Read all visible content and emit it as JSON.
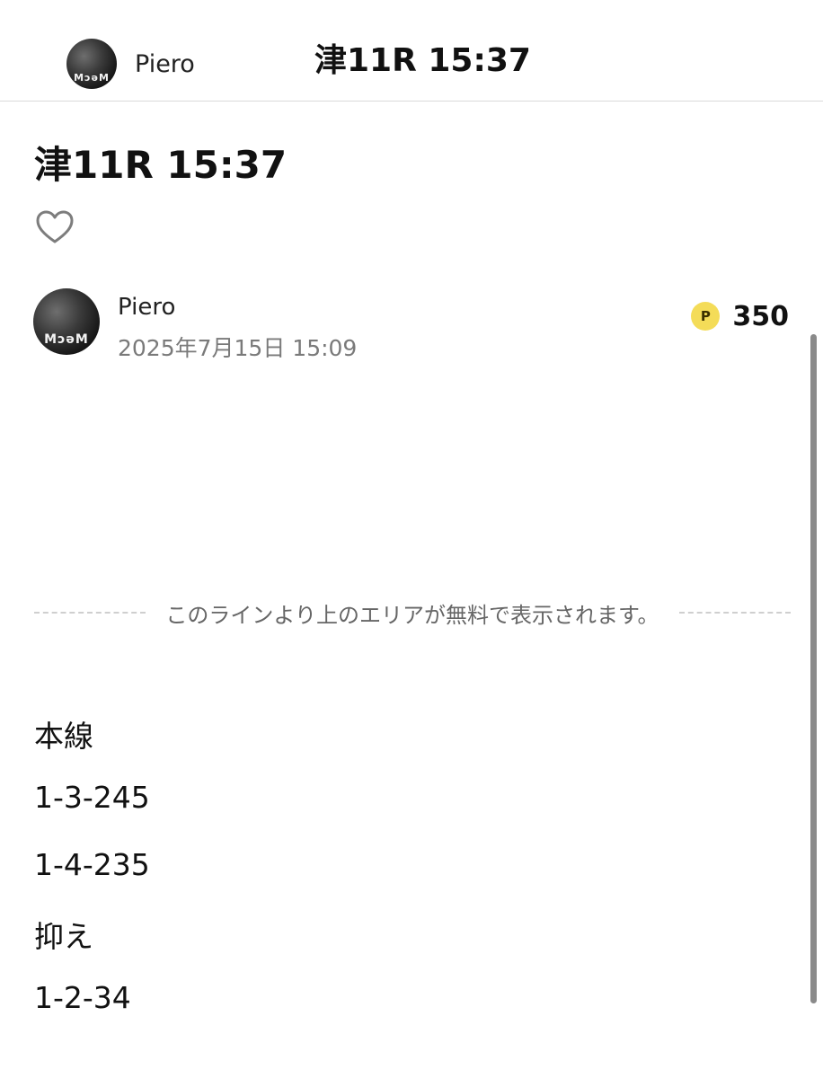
{
  "header": {
    "author": "Piero",
    "title": "津11R 15:37"
  },
  "article": {
    "title": "津11R 15:37",
    "author_name": "Piero",
    "published": "2025年7月15日 15:09",
    "price_symbol": "P",
    "price": "350",
    "free_area_notice": "このラインより上のエリアが無料で表示されます。",
    "lines": [
      "本線",
      "1-3-245",
      "1-4-235",
      "抑え",
      "1-2-34"
    ]
  },
  "avatar_text": "MɔəM",
  "icons": {
    "like": "heart-outline-icon",
    "price": "point-coin-icon"
  },
  "colors": {
    "coin": "#f4dc58",
    "muted": "#7a7a7a"
  }
}
